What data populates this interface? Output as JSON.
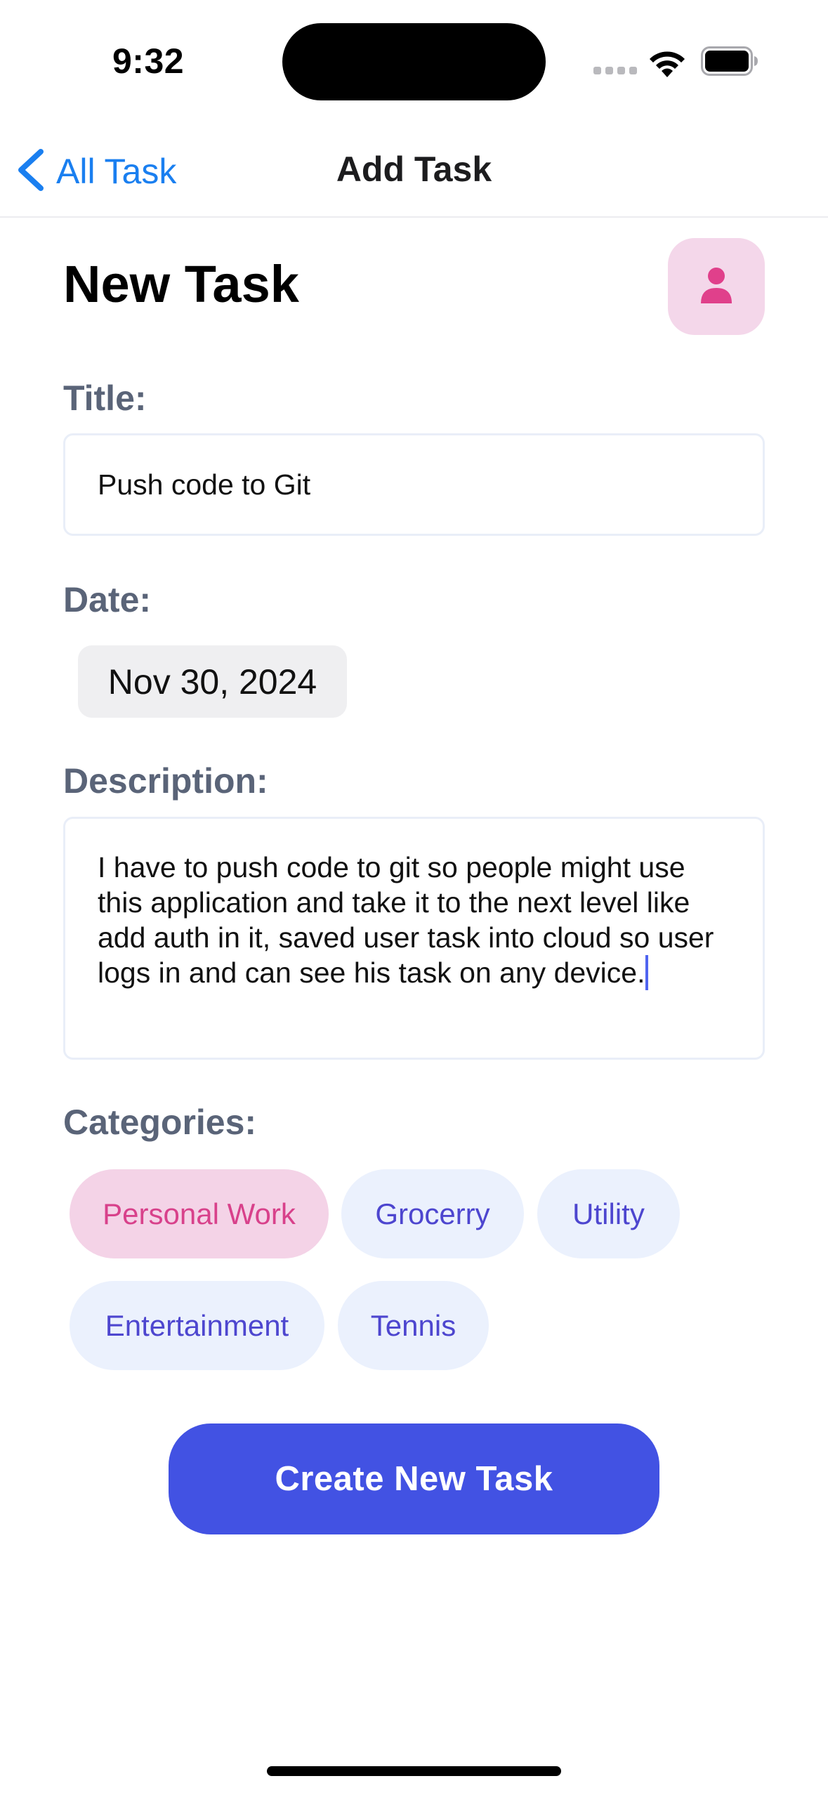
{
  "status_bar": {
    "time": "9:32"
  },
  "nav": {
    "back_label": "All Task",
    "title": "Add Task"
  },
  "header": {
    "title": "New Task"
  },
  "form": {
    "title_label": "Title:",
    "title_value": "Push code to Git",
    "date_label": "Date:",
    "date_value": "Nov 30, 2024",
    "description_label": "Description:",
    "description_value": "I have to push code to git so people might use this application and take it to the next level like add auth in it, saved user task into cloud so user logs in and can see his task on any device.",
    "categories_label": "Categories:",
    "categories": [
      {
        "label": "Personal Work",
        "selected": true
      },
      {
        "label": "Grocerry",
        "selected": false
      },
      {
        "label": "Utility",
        "selected": false
      },
      {
        "label": "Entertainment",
        "selected": false
      },
      {
        "label": "Tennis",
        "selected": false
      }
    ],
    "submit_label": "Create New Task"
  },
  "colors": {
    "accent": "#4252e3",
    "link": "#1a7ff0",
    "chip_bg": "#ebf1fd",
    "chip_text": "#4d46cf",
    "chip_selected_bg": "#f4d3e7",
    "chip_selected_text": "#d8418b",
    "label": "#5a6478"
  },
  "icons": [
    "chevron-left-icon",
    "person-icon",
    "wifi-icon",
    "battery-icon",
    "cellular-signal-icon"
  ]
}
